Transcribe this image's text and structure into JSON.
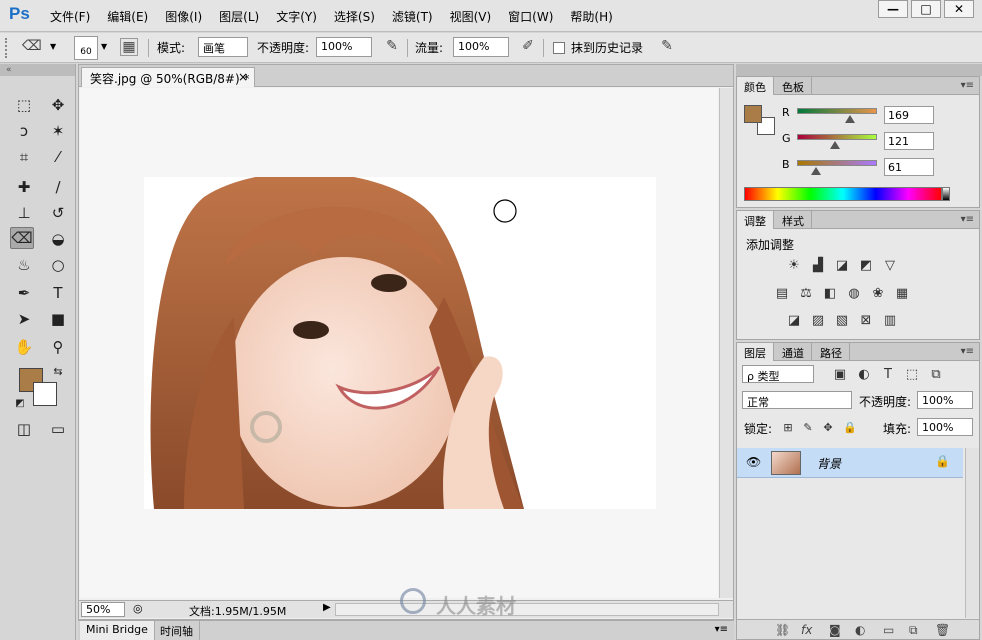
{
  "app": {
    "logo": "Ps"
  },
  "menu": [
    "文件(F)",
    "编辑(E)",
    "图像(I)",
    "图层(L)",
    "文字(Y)",
    "选择(S)",
    "滤镜(T)",
    "视图(V)",
    "窗口(W)",
    "帮助(H)"
  ],
  "window_buttons": {
    "minimize": "—",
    "maximize": "□",
    "close": "✕"
  },
  "options": {
    "brush_size": "60",
    "mode_label": "模式:",
    "mode_value": "画笔",
    "opacity_label": "不透明度:",
    "opacity_value": "100%",
    "flow_label": "流量:",
    "flow_value": "100%",
    "erase_history_label": "抹到历史记录"
  },
  "document": {
    "tab_title": "笑容.jpg @ 50%(RGB/8#) *",
    "tab_close": "×",
    "zoom": "50%",
    "doc_info": "文档:1.95M/1.95M"
  },
  "bottom_tabs": [
    "Mini Bridge",
    "时间轴"
  ],
  "color_panel": {
    "tabs": [
      "颜色",
      "色板"
    ],
    "fg_color": "#a97c48",
    "bg_color": "#ffffff",
    "channels": [
      {
        "label": "R",
        "value": "169",
        "fraction": 0.663
      },
      {
        "label": "G",
        "value": "121",
        "fraction": 0.475
      },
      {
        "label": "B",
        "value": "61",
        "fraction": 0.239
      }
    ]
  },
  "adjust_panel": {
    "tabs": [
      "调整",
      "样式"
    ],
    "title": "添加调整"
  },
  "layers_panel": {
    "tabs": [
      "图层",
      "通道",
      "路径"
    ],
    "filter": "ρ 类型",
    "blend_mode": "正常",
    "opacity_label": "不透明度:",
    "opacity_value": "100%",
    "lock_label": "锁定:",
    "fill_label": "填充:",
    "fill_value": "100%",
    "layer_name": "背景"
  },
  "watermark": "人人素材"
}
